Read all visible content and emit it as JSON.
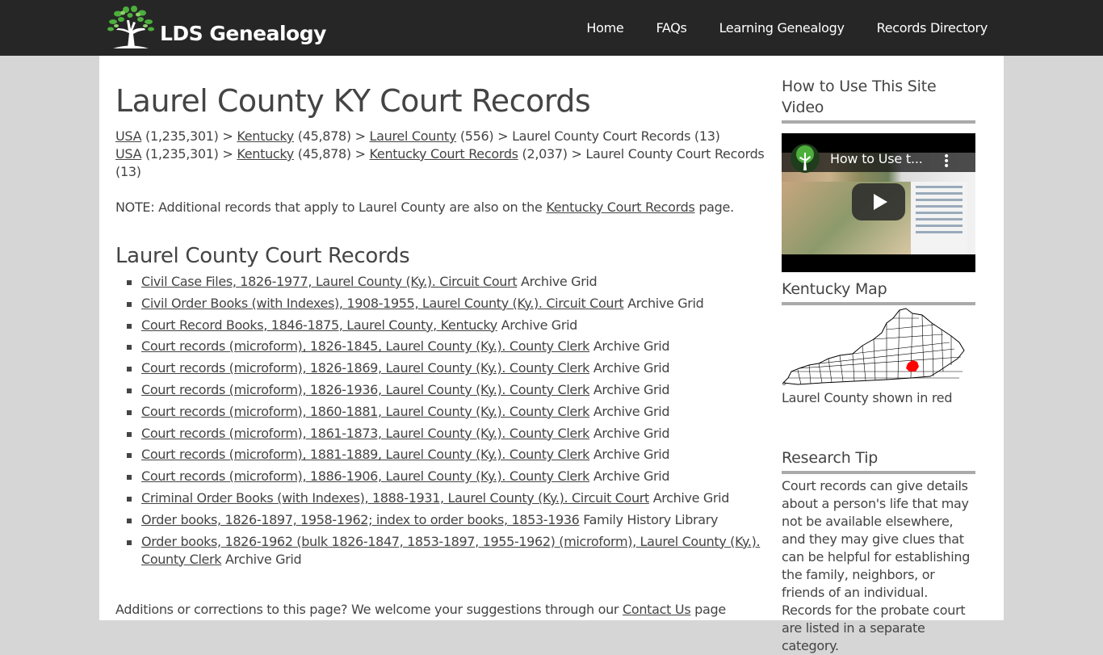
{
  "header": {
    "logo_text": "LDS Genealogy",
    "nav": [
      {
        "label": "Home"
      },
      {
        "label": "FAQs"
      },
      {
        "label": "Learning Genealogy"
      },
      {
        "label": "Records Directory"
      }
    ]
  },
  "main": {
    "title": "Laurel County KY Court Records",
    "breadcrumbs": [
      [
        {
          "link": "USA",
          "count": " (1,235,301) > "
        },
        {
          "link": "Kentucky",
          "count": " (45,878) > "
        },
        {
          "link": "Laurel County",
          "count": " (556) > "
        },
        {
          "text": "Laurel County Court Records (13)"
        }
      ],
      [
        {
          "link": "USA",
          "count": " (1,235,301) > "
        },
        {
          "link": "Kentucky",
          "count": " (45,878) > "
        },
        {
          "link": "Kentucky Court Records",
          "count": " (2,037) > "
        },
        {
          "text": "Laurel County Court Records (13)"
        }
      ]
    ],
    "note": {
      "before": "NOTE: Additional records that apply to Laurel County are also on the ",
      "link": "Kentucky Court Records",
      "after": " page."
    },
    "section_title": "Laurel County Court Records",
    "records": [
      {
        "title": "Civil Case Files, 1826-1977, Laurel County (Ky.). Circuit Court",
        "source": "Archive Grid"
      },
      {
        "title": "Civil Order Books (with Indexes), 1908-1955, Laurel County (Ky.). Circuit Court",
        "source": "Archive Grid"
      },
      {
        "title": "Court Record Books, 1846-1875, Laurel County, Kentucky",
        "source": "Archive Grid"
      },
      {
        "title": "Court records (microform), 1826-1845, Laurel County (Ky.). County Clerk",
        "source": "Archive Grid"
      },
      {
        "title": "Court records (microform), 1826-1869, Laurel County (Ky.). County Clerk",
        "source": "Archive Grid"
      },
      {
        "title": "Court records (microform), 1826-1936, Laurel County (Ky.). County Clerk",
        "source": "Archive Grid"
      },
      {
        "title": "Court records (microform), 1860-1881, Laurel County (Ky.). County Clerk",
        "source": "Archive Grid"
      },
      {
        "title": "Court records (microform), 1861-1873, Laurel County (Ky.). County Clerk",
        "source": "Archive Grid"
      },
      {
        "title": "Court records (microform), 1881-1889, Laurel County (Ky.). County Clerk",
        "source": "Archive Grid"
      },
      {
        "title": "Court records (microform), 1886-1906, Laurel County (Ky.). County Clerk",
        "source": "Archive Grid"
      },
      {
        "title": "Criminal Order Books (with Indexes), 1888-1931, Laurel County (Ky.). Circuit Court",
        "source": "Archive Grid"
      },
      {
        "title": "Order books, 1826-1897, 1958-1962; index to order books, 1853-1936",
        "source": "Family History Library"
      },
      {
        "title": "Order books, 1826-1962 (bulk 1826-1847, 1853-1897, 1955-1962) (microform), Laurel County (Ky.). County Clerk",
        "source": "Archive Grid"
      }
    ],
    "footer": {
      "before": "Additions or corrections to this page? We welcome your suggestions through our ",
      "link": "Contact Us",
      "after": " page"
    }
  },
  "sidebar": {
    "video": {
      "title": "How to Use This Site Video",
      "video_title": "How to Use t..."
    },
    "map": {
      "title": "Kentucky Map",
      "caption": "Laurel County shown in red",
      "highlight_color": "#ff0000"
    },
    "tip": {
      "title": "Research Tip",
      "text": "Court records can give details about a person's life that may not be available elsewhere, and they may give clues that can be helpful for establishing the family, neighbors, or friends of an individual.  Records for the probate court are listed in a separate category."
    }
  }
}
